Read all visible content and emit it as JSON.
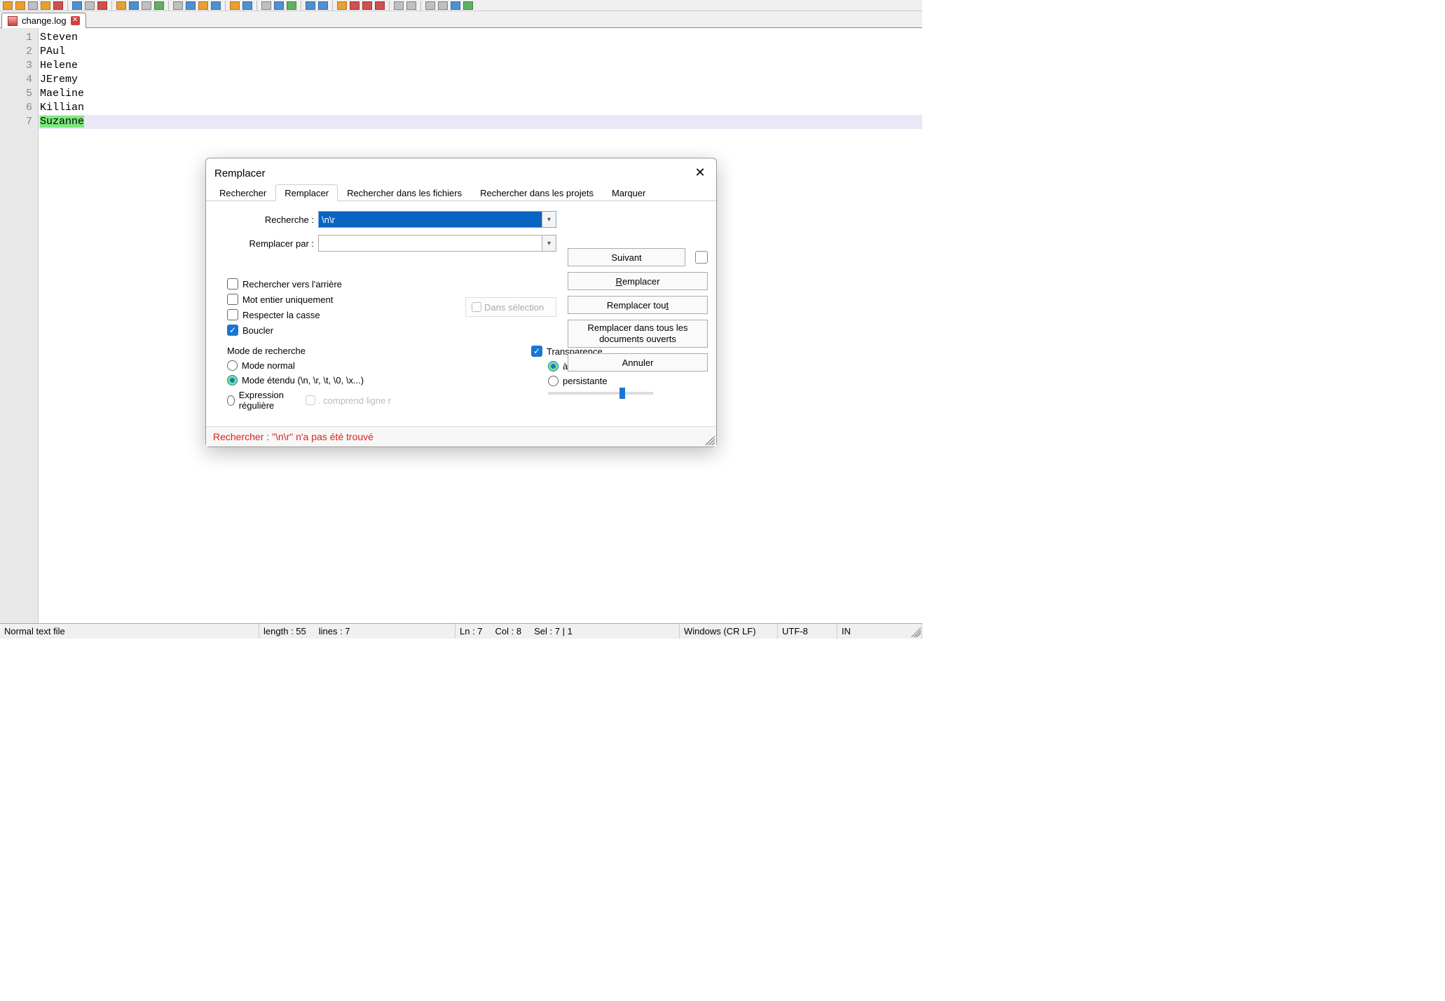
{
  "tab": {
    "filename": "change.log"
  },
  "lines": [
    "Steven",
    "PAul",
    "Helene",
    "JEremy",
    "Maeline",
    "Killian",
    "Suzanne"
  ],
  "selected_line_index": 6,
  "dialog": {
    "title": "Remplacer",
    "tabs": {
      "search": "Rechercher",
      "replace": "Remplacer",
      "find_in_files": "Rechercher dans les fichiers",
      "find_in_projects": "Rechercher dans les projets",
      "mark": "Marquer"
    },
    "active_tab": "replace",
    "search_label": "Recherche :",
    "search_value": "\\n\\r",
    "replace_label": "Remplacer par :",
    "replace_value": "",
    "in_selection": "Dans sélection",
    "buttons": {
      "next": "Suivant",
      "replace": "Remplacer",
      "replace_all": "Remplacer tout",
      "replace_all_open": "Remplacer dans tous les documents ouverts",
      "cancel": "Annuler"
    },
    "options": {
      "backward": "Rechercher vers l'arrière",
      "whole_word": "Mot entier uniquement",
      "match_case": "Respecter la casse",
      "wrap": "Boucler",
      "wrap_checked": true
    },
    "search_mode": {
      "title": "Mode de recherche",
      "normal": "Mode normal",
      "extended": "Mode étendu (\\n, \\r, \\t, \\0, \\x...)",
      "regex": "Expression régulière",
      "regex_nl": ". comprend ligne r",
      "selected": "extended"
    },
    "transparency": {
      "title": "Transparence",
      "enabled": true,
      "on_loss": "à la perte du focus",
      "persistent": "persistante",
      "selected": "on_loss"
    },
    "status": "Rechercher : \"\\n\\r\" n'a pas été trouvé"
  },
  "status": {
    "filetype": "Normal text file",
    "length_label": "length : 55",
    "lines_label": "lines : 7",
    "ln": "Ln : 7",
    "col": "Col : 8",
    "sel": "Sel : 7 | 1",
    "eol": "Windows (CR LF)",
    "encoding": "UTF-8",
    "ins": "IN"
  }
}
